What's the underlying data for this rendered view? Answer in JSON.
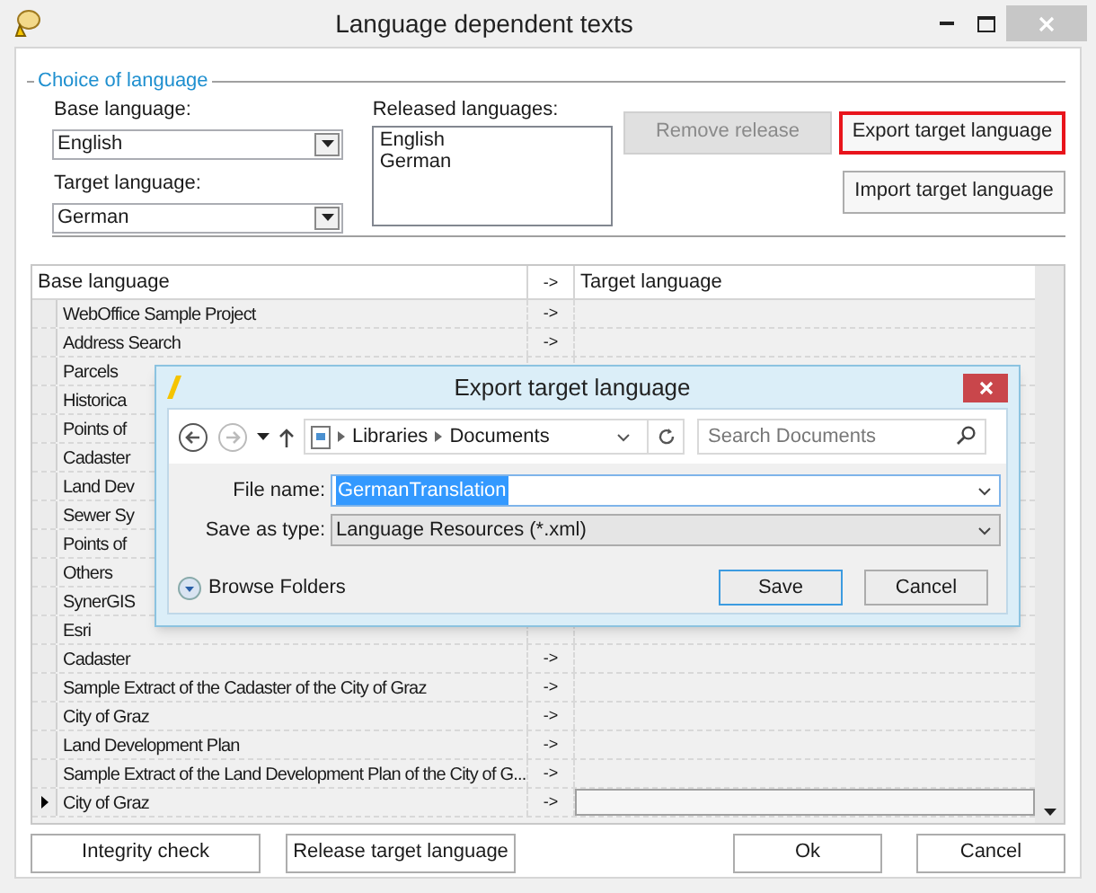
{
  "window": {
    "title": "Language dependent texts"
  },
  "choice_group": {
    "title": "Choice of language",
    "base_language": {
      "label": "Base language:",
      "value": "English"
    },
    "target_language": {
      "label": "Target language:",
      "value": "German"
    },
    "released_languages": {
      "label": "Released languages:",
      "items": [
        "English",
        "German"
      ]
    },
    "buttons": [
      {
        "label": "Remove release",
        "disabled": true,
        "highlighted": false
      },
      {
        "label": "Export target language",
        "disabled": false,
        "highlighted": true
      },
      {
        "label": "Import target language",
        "disabled": false,
        "highlighted": false
      }
    ]
  },
  "grid": {
    "columns": [
      "Base language",
      "->",
      "Target language"
    ],
    "rows": [
      {
        "base": "WebOffice Sample Project",
        "arrow": "->",
        "selected": false
      },
      {
        "base": "Address Search",
        "arrow": "->",
        "selected": false
      },
      {
        "base": "Parcels",
        "selected": false
      },
      {
        "base": "Historica",
        "selected": false
      },
      {
        "base": "Points of",
        "selected": false
      },
      {
        "base": "Cadaster",
        "selected": false
      },
      {
        "base": "Land Dev",
        "selected": false
      },
      {
        "base": "Sewer Sy",
        "selected": false
      },
      {
        "base": "Points of",
        "selected": false
      },
      {
        "base": "Others",
        "selected": false
      },
      {
        "base": "SynerGIS",
        "selected": false
      },
      {
        "base": "Esri",
        "selected": false
      },
      {
        "base": "Cadaster",
        "arrow": "->",
        "selected": false
      },
      {
        "base": "Sample Extract of the Cadaster of the City of Graz",
        "arrow": "->",
        "selected": false
      },
      {
        "base": "City of Graz",
        "arrow": "->",
        "selected": false
      },
      {
        "base": "Land Development Plan",
        "arrow": "->",
        "selected": false
      },
      {
        "base": "Sample Extract of the Land Development Plan of the City of G...",
        "arrow": "->",
        "selected": false
      },
      {
        "base": "City of Graz",
        "arrow": "->",
        "selected": true
      }
    ]
  },
  "buttons": [
    "Integrity check",
    "Release target language",
    "Ok",
    "Cancel"
  ],
  "export_dialog": {
    "title": "Export target language",
    "path": [
      "Libraries",
      "Documents"
    ],
    "search": {
      "placeholder": "Search Documents"
    },
    "file_name": {
      "label": "File name:",
      "value": "GermanTranslation"
    },
    "save_as_type": {
      "label": "Save as type:",
      "value": "Language Resources (*.xml)"
    },
    "browse_folders": "Browse Folders",
    "buttons": [
      "Save",
      "Cancel"
    ]
  }
}
